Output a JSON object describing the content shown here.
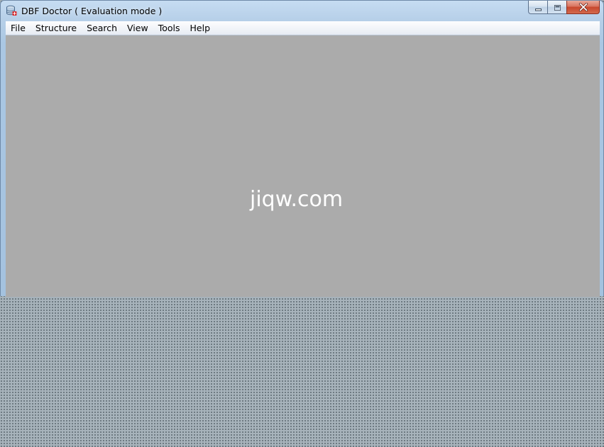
{
  "window": {
    "title": "DBF Doctor ( Evaluation mode )",
    "app_icon": "database-icon"
  },
  "caption_buttons": {
    "minimize_icon": "minimize-icon",
    "maximize_icon": "maximize-icon",
    "close_icon": "close-icon"
  },
  "menu": {
    "items": [
      {
        "label": "File"
      },
      {
        "label": "Structure"
      },
      {
        "label": "Search"
      },
      {
        "label": "View"
      },
      {
        "label": "Tools"
      },
      {
        "label": "Help"
      }
    ]
  },
  "watermark": {
    "text": "jiqw.com"
  },
  "colors": {
    "client_background": "#ababab",
    "desktop_background": "#a7b3bb",
    "close_button": "#c7472d",
    "watermark": "#ffffff"
  }
}
